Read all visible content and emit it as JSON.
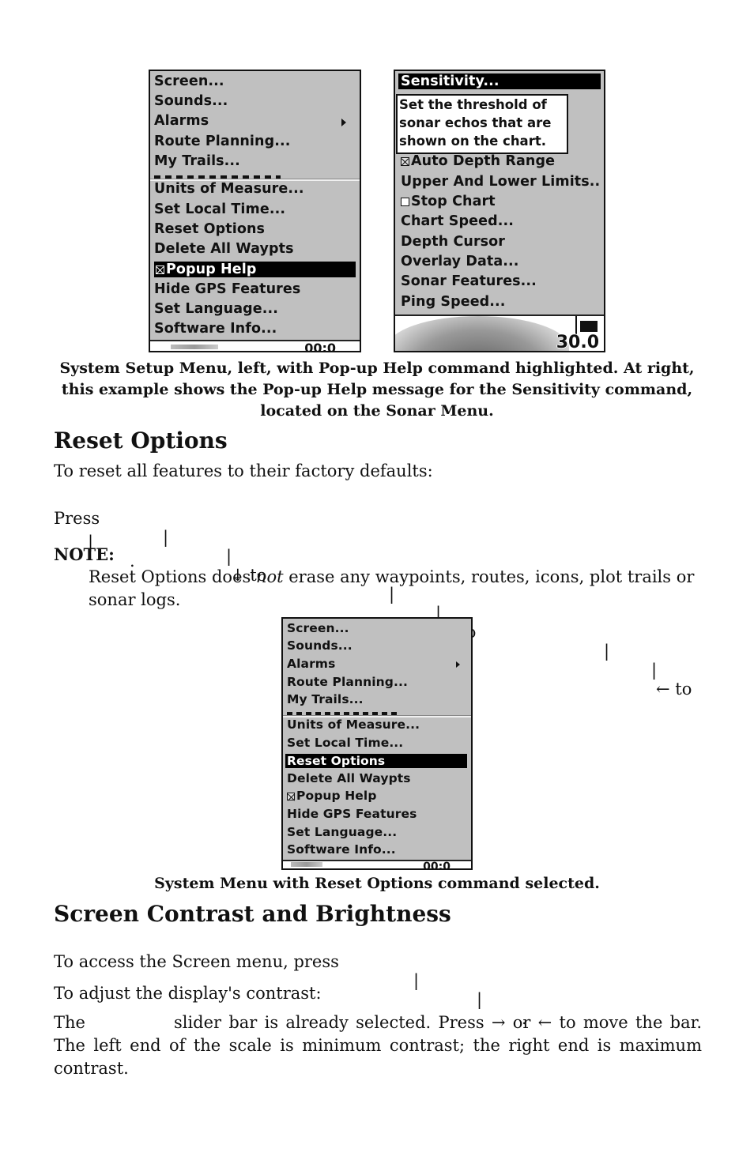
{
  "figure1": {
    "system_menu": {
      "items": [
        "Screen...",
        "Sounds...",
        "Alarms",
        "Route Planning...",
        "My Trails...",
        "Units of Measure...",
        "Set Local Time...",
        "Reset Options",
        "Delete All Waypts",
        "Popup Help",
        "Hide GPS Features",
        "Set Language...",
        "Software Info..."
      ],
      "selected": "Popup Help",
      "popup_help_checked": true,
      "footer_text": "00:0"
    },
    "sonar_menu": {
      "items": [
        "Sensitivity...",
        "Auto Depth Range",
        "Upper And Lower Limits..",
        "Stop Chart",
        "Chart Speed...",
        "Depth Cursor",
        "Overlay Data...",
        "Sonar Features...",
        "Ping Speed..."
      ],
      "selected": "Sensitivity...",
      "auto_depth_range_checked": true,
      "stop_chart_checked": false,
      "popup_help_lines": [
        "Set the threshold of",
        "sonar echos that are",
        "shown on the chart."
      ],
      "depth_readout": "30.0"
    },
    "caption": "System Setup Menu, left, with Pop-up Help command highlighted. At right, this example shows the Pop-up Help message for the Sensitivity command, located on the Sonar Menu."
  },
  "reset_section": {
    "heading": "Reset Options",
    "intro": "To reset all features to their factory defaults:",
    "steps": {
      "press": "Press",
      "sep": "|",
      "down_to": "↓ to",
      "left_to": "← to",
      "period": "."
    },
    "note_label": "NOTE:",
    "note_pre": "Reset Options does ",
    "note_em": "not",
    "note_post": " erase any waypoints, routes, icons, plot trails or sonar logs."
  },
  "figure2": {
    "system_menu": {
      "items": [
        "Screen...",
        "Sounds...",
        "Alarms",
        "Route Planning...",
        "My Trails...",
        "Units of Measure...",
        "Set Local Time...",
        "Reset Options",
        "Delete All Waypts",
        "Popup Help",
        "Hide GPS Features",
        "Set Language...",
        "Software Info..."
      ],
      "selected": "Reset Options",
      "popup_help_checked": true,
      "footer_text": "00:0"
    },
    "caption": "System Menu with Reset Options command selected."
  },
  "contrast_section": {
    "heading": "Screen Contrast and Brightness",
    "access_text": "To access the Screen menu, press",
    "sep": "|",
    "period": ".",
    "adjust_intro": "To adjust the display's contrast:",
    "adjust_p1": "The",
    "adjust_p2": "slider bar is already selected. Press → or ← to move the bar. The left end of the scale is minimum contrast; the right end is maximum contrast."
  }
}
